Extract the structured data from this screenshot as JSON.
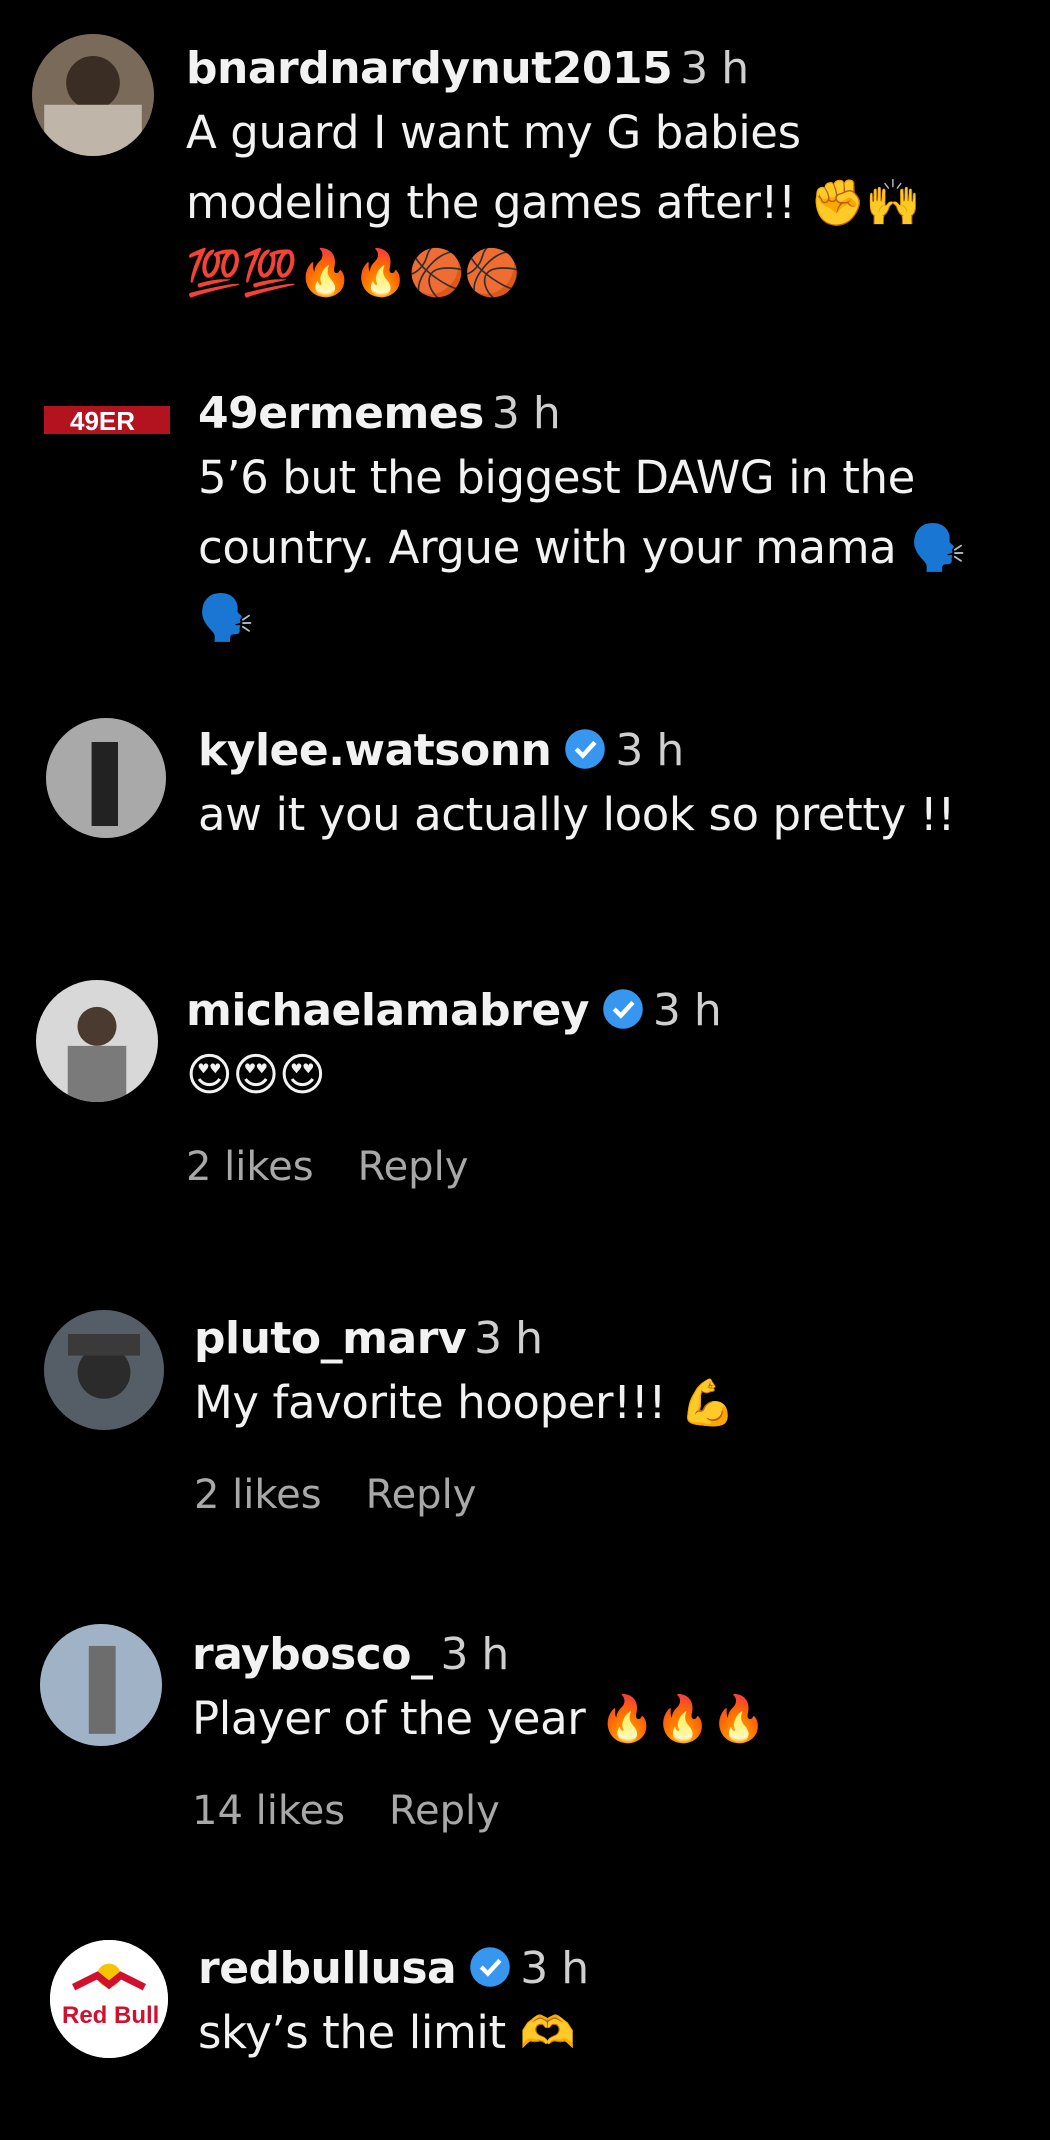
{
  "comments": [
    {
      "username": "bnardnardynut2015",
      "time": "3 h",
      "verified": false,
      "text_lines": [
        "A guard I want my G babies",
        "modeling the games after!! ✊🙌"
      ],
      "emoji_line": "💯💯🔥🔥🏀🏀"
    },
    {
      "username": "49ermemes",
      "time": "3 h",
      "verified": false,
      "avatar_text": "49ER",
      "text_lines": [
        "5’6 but the biggest DAWG in the",
        "country. Argue with your mama 🗣️"
      ],
      "emoji_line": "🗣️"
    },
    {
      "username": "kylee.watsonn",
      "time": "3 h",
      "verified": true,
      "text_lines": [
        "aw it you actually look so pretty !!"
      ]
    },
    {
      "username": "michaelamabrey",
      "time": "3 h",
      "verified": true,
      "emoji_line": "😍😍😍",
      "likes": "2 likes",
      "reply": "Reply"
    },
    {
      "username": "pluto_marv",
      "time": "3 h",
      "verified": false,
      "text_lines": [
        "My favorite hooper!!! 💪"
      ],
      "likes": "2 likes",
      "reply": "Reply"
    },
    {
      "username": "raybosco_",
      "time": "3 h",
      "verified": false,
      "text_lines": [
        "Player of the year 🔥🔥🔥"
      ],
      "likes": "14 likes",
      "reply": "Reply"
    },
    {
      "username": "redbullusa",
      "time": "3 h",
      "verified": true,
      "avatar_text": "Red Bull",
      "text_lines": [
        "sky’s the limit 🫶"
      ]
    }
  ],
  "colors": {
    "background": "#000000",
    "verified": "#3797f0",
    "redbull": "#d1102f"
  }
}
